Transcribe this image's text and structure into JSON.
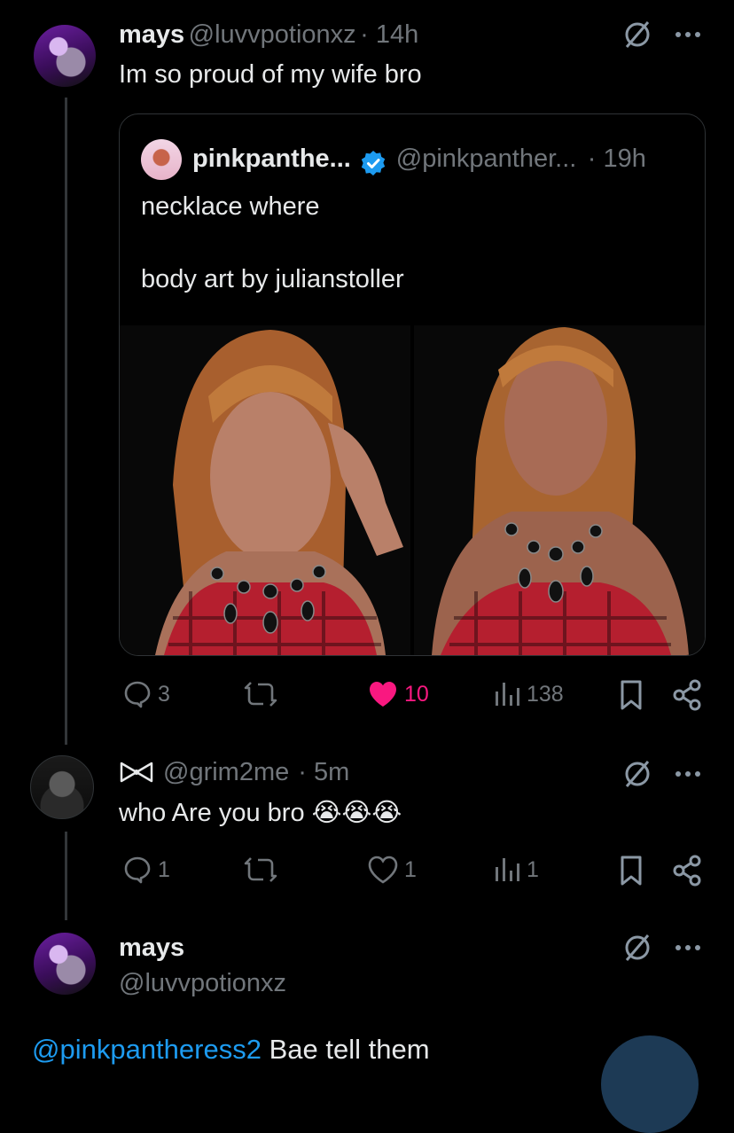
{
  "posts": [
    {
      "name": "mays",
      "handle": "@luvvpotionxz",
      "time": "· 14h",
      "text": "Im so proud of my wife bro"
    },
    {
      "handle": "@grim2me",
      "time": "· 5m",
      "text": "who Are you bro",
      "emojis": "😭😭😭",
      "stats": {
        "replies": "1",
        "likes": "1",
        "views": "1"
      }
    },
    {
      "name": "mays",
      "handle": "@luvvpotionxz",
      "mention": "@pinkpantheress2",
      "text": " Bae tell them"
    }
  ],
  "quote": {
    "name": "pinkpanthe...",
    "handle": "@pinkpanther...",
    "time": "· 19h",
    "line1": "necklace where",
    "line2": "body art by julianstoller",
    "stats": {
      "replies": "3",
      "likes": "10",
      "views": "138"
    }
  },
  "colors": {
    "background": "#000000",
    "text": "#e7e9ea",
    "muted": "#71767b",
    "like_active": "#f91880",
    "link": "#1d9bf0",
    "border": "#2f3336"
  },
  "icons": [
    "grok-icon",
    "more-icon",
    "reply-icon",
    "repost-icon",
    "like-icon",
    "views-icon",
    "bookmark-icon",
    "share-icon",
    "verified-icon",
    "bow-icon"
  ]
}
